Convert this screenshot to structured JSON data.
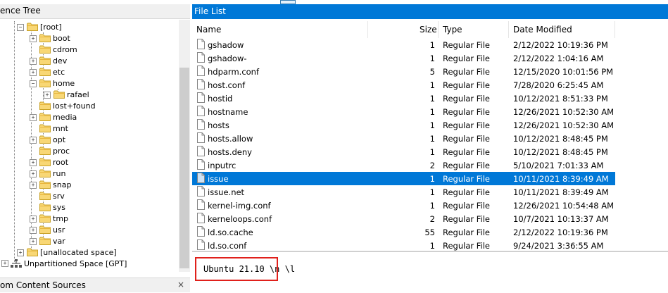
{
  "left_panel": {
    "title": "ence Tree",
    "tree": [
      {
        "label": "[root]",
        "expander": "−"
      },
      {
        "label": "boot",
        "expander": "+"
      },
      {
        "label": "cdrom",
        "expander": ""
      },
      {
        "label": "dev",
        "expander": "+"
      },
      {
        "label": "etc",
        "expander": "+"
      },
      {
        "label": "home",
        "expander": "−"
      },
      {
        "label": "rafael",
        "expander": "+"
      },
      {
        "label": "lost+found",
        "expander": ""
      },
      {
        "label": "media",
        "expander": "+"
      },
      {
        "label": "mnt",
        "expander": ""
      },
      {
        "label": "opt",
        "expander": "+"
      },
      {
        "label": "proc",
        "expander": ""
      },
      {
        "label": "root",
        "expander": "+"
      },
      {
        "label": "run",
        "expander": "+"
      },
      {
        "label": "snap",
        "expander": "+"
      },
      {
        "label": "srv",
        "expander": ""
      },
      {
        "label": "sys",
        "expander": ""
      },
      {
        "label": "tmp",
        "expander": "+"
      },
      {
        "label": "usr",
        "expander": "+"
      },
      {
        "label": "var",
        "expander": "+"
      },
      {
        "label": "[unallocated space]",
        "expander": "+"
      },
      {
        "label": "Unpartitioned Space [GPT]",
        "expander": "+"
      }
    ],
    "bottom_title": "om Content Sources",
    "close_glyph": "×"
  },
  "file_list": {
    "title": "File List",
    "columns": {
      "name": "Name",
      "size": "Size",
      "type": "Type",
      "date": "Date Modified"
    },
    "rows": [
      {
        "name": "gshadow",
        "size": "1",
        "type": "Regular File",
        "date": "2/12/2022 10:19:36 PM"
      },
      {
        "name": "gshadow-",
        "size": "1",
        "type": "Regular File",
        "date": "2/12/2022 1:04:16 AM"
      },
      {
        "name": "hdparm.conf",
        "size": "5",
        "type": "Regular File",
        "date": "12/15/2020 10:01:56 PM"
      },
      {
        "name": "host.conf",
        "size": "1",
        "type": "Regular File",
        "date": "7/28/2020 6:25:45 AM"
      },
      {
        "name": "hostid",
        "size": "1",
        "type": "Regular File",
        "date": "10/12/2021 8:51:33 PM"
      },
      {
        "name": "hostname",
        "size": "1",
        "type": "Regular File",
        "date": "12/26/2021 10:52:30 AM"
      },
      {
        "name": "hosts",
        "size": "1",
        "type": "Regular File",
        "date": "12/26/2021 10:52:30 AM"
      },
      {
        "name": "hosts.allow",
        "size": "1",
        "type": "Regular File",
        "date": "10/12/2021 8:48:45 PM"
      },
      {
        "name": "hosts.deny",
        "size": "1",
        "type": "Regular File",
        "date": "10/12/2021 8:48:45 PM"
      },
      {
        "name": "inputrc",
        "size": "2",
        "type": "Regular File",
        "date": "5/10/2021 7:01:33 AM"
      },
      {
        "name": "issue",
        "size": "1",
        "type": "Regular File",
        "date": "10/11/2021 8:39:49 AM",
        "selected": true
      },
      {
        "name": "issue.net",
        "size": "1",
        "type": "Regular File",
        "date": "10/11/2021 8:39:49 AM"
      },
      {
        "name": "kernel-img.conf",
        "size": "1",
        "type": "Regular File",
        "date": "12/26/2021 10:54:48 AM"
      },
      {
        "name": "kerneloops.conf",
        "size": "2",
        "type": "Regular File",
        "date": "10/7/2021 10:13:37 AM"
      },
      {
        "name": "ld.so.cache",
        "size": "55",
        "type": "Regular File",
        "date": "2/12/2022 10:19:36 PM"
      },
      {
        "name": "ld.so.conf",
        "size": "1",
        "type": "Regular File",
        "date": "9/24/2021 3:36:55 AM"
      }
    ]
  },
  "preview": {
    "text": "Ubuntu 21.10 \\n \\l"
  },
  "colors": {
    "accent": "#0078d7",
    "highlight_box": "#e0201b"
  }
}
